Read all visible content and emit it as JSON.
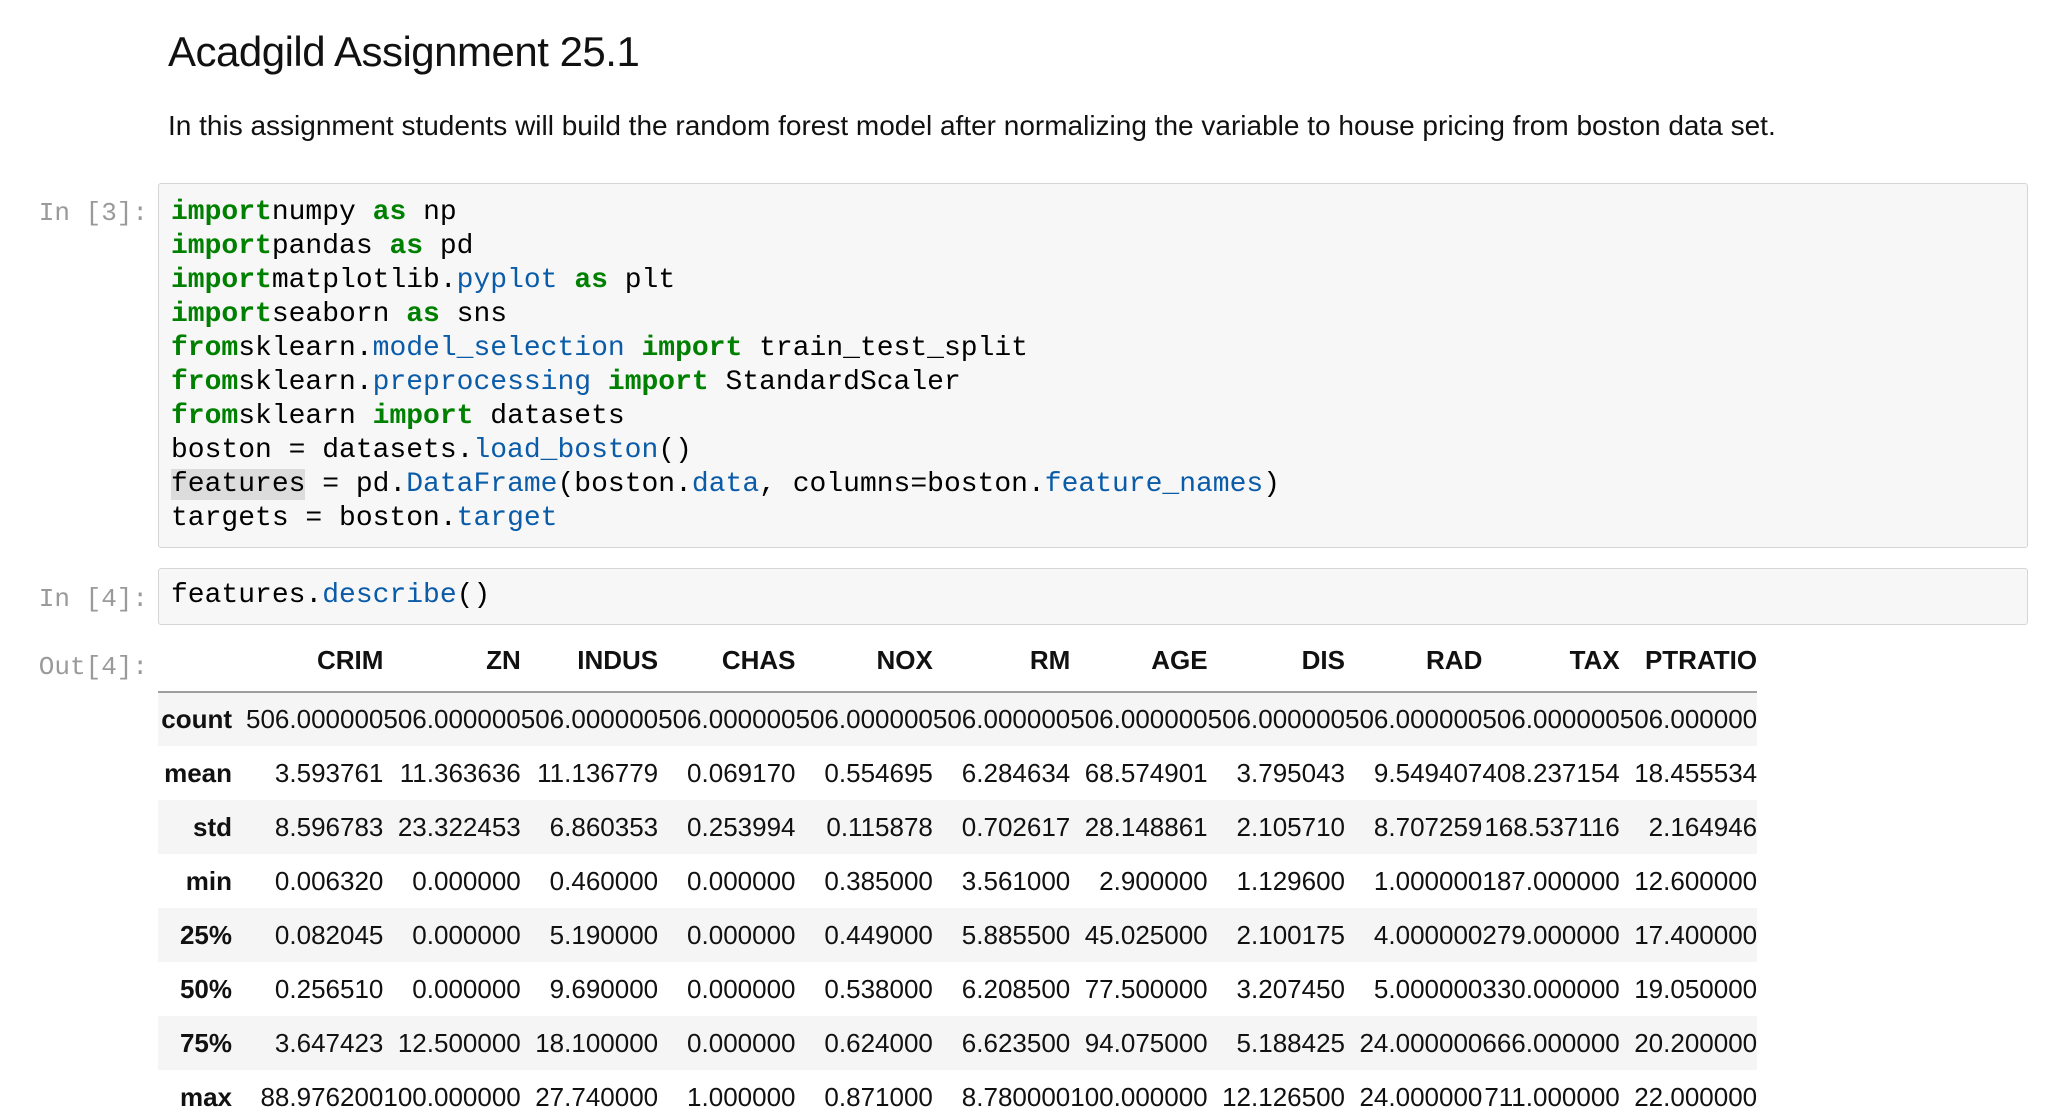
{
  "markdown": {
    "title": "Acadgild Assignment 25.1",
    "paragraph": "In this assignment students will build the random forest model after normalizing the variable to house pricing from boston data set."
  },
  "cells": [
    {
      "prompt": "In [3]:",
      "lines": [
        [
          [
            "kw",
            "import"
          ],
          [
            "",
            "numpy "
          ],
          [
            "kw",
            "as"
          ],
          [
            "",
            " np"
          ]
        ],
        [
          [
            "kw",
            "import"
          ],
          [
            "",
            "pandas "
          ],
          [
            "kw",
            "as"
          ],
          [
            "",
            " pd"
          ]
        ],
        [
          [
            "kw",
            "import"
          ],
          [
            "",
            "matplotlib."
          ],
          [
            "at",
            "pyplot"
          ],
          [
            "",
            " "
          ],
          [
            "kw",
            "as"
          ],
          [
            "",
            " plt"
          ]
        ],
        [
          [
            "kw",
            "import"
          ],
          [
            "",
            "seaborn "
          ],
          [
            "kw",
            "as"
          ],
          [
            "",
            " sns"
          ]
        ],
        [
          [
            "kw",
            "from"
          ],
          [
            "",
            "sklearn."
          ],
          [
            "at",
            "model_selection"
          ],
          [
            "",
            " "
          ],
          [
            "kw",
            "import"
          ],
          [
            "",
            " train_test_split"
          ]
        ],
        [
          [
            "kw",
            "from"
          ],
          [
            "",
            "sklearn."
          ],
          [
            "at",
            "preprocessing"
          ],
          [
            "",
            " "
          ],
          [
            "kw",
            "import"
          ],
          [
            "",
            " StandardScaler"
          ]
        ],
        [
          [
            "kw",
            "from"
          ],
          [
            "",
            "sklearn "
          ],
          [
            "kw",
            "import"
          ],
          [
            "",
            " datasets"
          ]
        ],
        [
          [
            "",
            "boston = datasets."
          ],
          [
            "at",
            "load_boston"
          ],
          [
            "",
            "()"
          ]
        ],
        [
          [
            "hl",
            "features"
          ],
          [
            "",
            " = pd."
          ],
          [
            "at",
            "DataFrame"
          ],
          [
            "",
            "(boston."
          ],
          [
            "at",
            "data"
          ],
          [
            "",
            ", columns=boston."
          ],
          [
            "at",
            "feature_names"
          ],
          [
            "",
            ")"
          ]
        ],
        [
          [
            "",
            "targets = boston."
          ],
          [
            "at",
            "target"
          ]
        ]
      ]
    },
    {
      "prompt": "In [4]:",
      "lines": [
        [
          [
            "",
            "features."
          ],
          [
            "at",
            "describe"
          ],
          [
            "",
            "()"
          ]
        ]
      ]
    }
  ],
  "output": {
    "prompt": "Out[4]:",
    "columns": [
      "CRIM",
      "ZN",
      "INDUS",
      "CHAS",
      "NOX",
      "RM",
      "AGE",
      "DIS",
      "RAD",
      "TAX",
      "PTRATIO"
    ],
    "rows": [
      {
        "label": "count",
        "values": [
          "506.000000",
          "506.000000",
          "506.000000",
          "506.000000",
          "506.000000",
          "506.000000",
          "506.000000",
          "506.000000",
          "506.000000",
          "506.000000",
          "506.000000"
        ]
      },
      {
        "label": "mean",
        "values": [
          "3.593761",
          "11.363636",
          "11.136779",
          "0.069170",
          "0.554695",
          "6.284634",
          "68.574901",
          "3.795043",
          "9.549407",
          "408.237154",
          "18.455534"
        ]
      },
      {
        "label": "std",
        "values": [
          "8.596783",
          "23.322453",
          "6.860353",
          "0.253994",
          "0.115878",
          "0.702617",
          "28.148861",
          "2.105710",
          "8.707259",
          "168.537116",
          "2.164946"
        ]
      },
      {
        "label": "min",
        "values": [
          "0.006320",
          "0.000000",
          "0.460000",
          "0.000000",
          "0.385000",
          "3.561000",
          "2.900000",
          "1.129600",
          "1.000000",
          "187.000000",
          "12.600000"
        ]
      },
      {
        "label": "25%",
        "values": [
          "0.082045",
          "0.000000",
          "5.190000",
          "0.000000",
          "0.449000",
          "5.885500",
          "45.025000",
          "2.100175",
          "4.000000",
          "279.000000",
          "17.400000"
        ]
      },
      {
        "label": "50%",
        "values": [
          "0.256510",
          "0.000000",
          "9.690000",
          "0.000000",
          "0.538000",
          "6.208500",
          "77.500000",
          "3.207450",
          "5.000000",
          "330.000000",
          "19.050000"
        ]
      },
      {
        "label": "75%",
        "values": [
          "3.647423",
          "12.500000",
          "18.100000",
          "0.000000",
          "0.624000",
          "6.623500",
          "94.075000",
          "5.188425",
          "24.000000",
          "666.000000",
          "20.200000"
        ]
      },
      {
        "label": "max",
        "values": [
          "88.976200",
          "100.000000",
          "27.740000",
          "1.000000",
          "0.871000",
          "8.780000",
          "100.000000",
          "12.126500",
          "24.000000",
          "711.000000",
          "22.000000"
        ]
      }
    ]
  }
}
